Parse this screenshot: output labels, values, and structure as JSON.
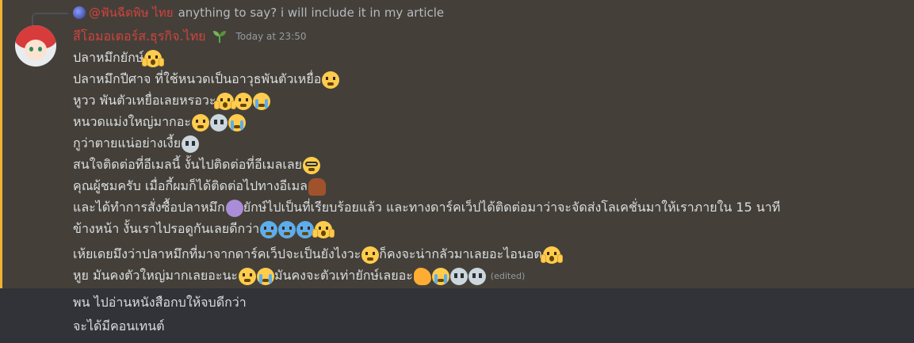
{
  "reply": {
    "username": "@ฟันฉีดพิษ ไทย",
    "text": "anything to say? i will include it in my article"
  },
  "message": {
    "username": "สีโอมอเตอร์ส.ธุรกิจ.ไทย",
    "timestamp": "Today at 23:50",
    "edited_label": "(edited)",
    "lines": [
      {
        "text": "ปลาหมึกยักษ์",
        "emojis": [
          "scream"
        ]
      },
      {
        "text": "ปลาหมึกปีศาจ ที่ใช้หนวดเป็นอาวุธพันตัวเหยื่อ",
        "emojis": [
          "anxious"
        ]
      },
      {
        "text": "หูวว พันตัวเหยื่อเลยหรอวะ",
        "emojis": [
          "scream",
          "anxious",
          "sob"
        ]
      },
      {
        "text": "หนวดแม่งใหญ่มากอะ",
        "emojis": [
          "smirk",
          "skull",
          "sob"
        ]
      },
      {
        "text": "กูว่าตายแน่อย่างเงี้ย",
        "emojis": [
          "skull"
        ]
      },
      {
        "text": "สนใจติดต่อที่อีเมลนี้ งั้นไปติดต่อที่อีเมลเลย",
        "emojis": [
          "nerd"
        ]
      },
      {
        "text": "คุณผู้ชมครับ เมื่อกี้ผมก็ได้ติดต่อไปทางอีเมล",
        "emojis": [
          "horse"
        ]
      },
      {
        "text_a": "และได้ทำการสั่งซื้อปลาหมึก",
        "text_b": "ยักษ์ไปเป็นที่เรียบร้อยแล้ว และทางดาร์คเว็ปได้ติดต่อมาว่าจะจัดส่งโลเคชั่นมาให้เราภายใน 15 นาที",
        "emojis": [
          "octopus"
        ]
      },
      {
        "text": "ข้างหน้า งั้นเราไปรอดูกันเลยดีกว่า",
        "emojis": [
          "cold",
          "cold",
          "cold",
          "scream"
        ]
      },
      {
        "text_a": "เห้ยเดยมึงว่าปลาหมึกที่มาจากดาร์คเว็ปจะเป็นยังไงวะ",
        "text_b": " ก็คงจะน่ากลัวมาเลยอะไอนอต",
        "emojis": [
          "thinking",
          "scream"
        ]
      },
      {
        "text_a": "หูย มันคงตัวใหญ่มากเลยอะนะ",
        "text_b": " มันคงจะตัวเท่ายักษ์เลยอะ",
        "emojis": [
          "anxious",
          "sob",
          "muscle",
          "sob",
          "skull",
          "skull"
        ]
      }
    ]
  },
  "followups": [
    "พน ไปอ่านหนังสือกบให้จบดีกว่า",
    "จะได้มีคอนเทนต์"
  ],
  "colors": {
    "background": "#313338",
    "highlight": "#444039",
    "highlight_bar": "#f0b232",
    "username": "#d1433d",
    "text": "#dbdee1",
    "muted": "#949ba4"
  }
}
